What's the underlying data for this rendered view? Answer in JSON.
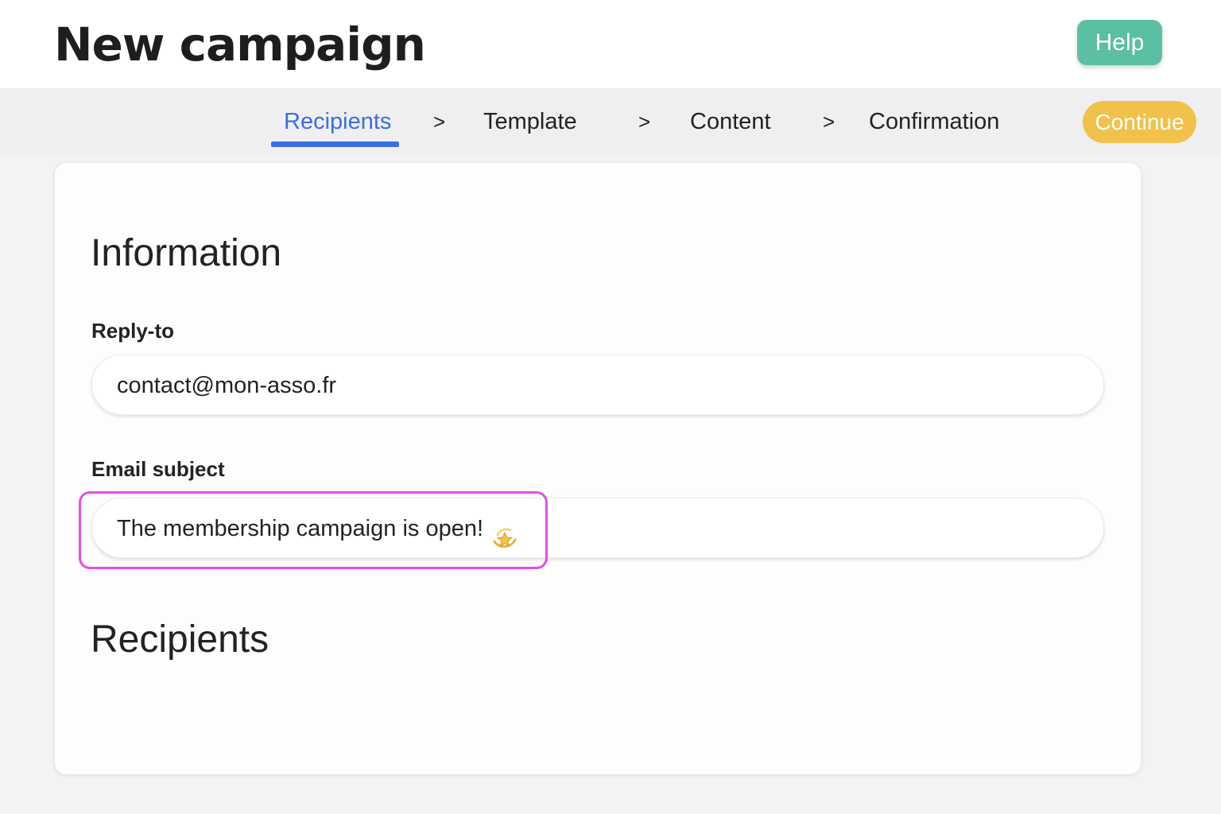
{
  "header": {
    "title": "New campaign",
    "help_label": "Help"
  },
  "stepper": {
    "steps": [
      {
        "label": "Recipients",
        "active": true
      },
      {
        "label": "Template",
        "active": false
      },
      {
        "label": "Content",
        "active": false
      },
      {
        "label": "Confirmation",
        "active": false
      }
    ],
    "separator": ">",
    "continue_label": "Continue"
  },
  "form": {
    "information_title": "Information",
    "reply_to": {
      "label": "Reply-to",
      "value": "contact@mon-asso.fr"
    },
    "email_subject": {
      "label": "Email subject",
      "value": "The membership campaign is open!",
      "emoji_icon": "dizzy-star-icon"
    },
    "recipients_title": "Recipients"
  },
  "colors": {
    "accent_blue": "#3a6fe0",
    "help_green": "#5bbfa4",
    "continue_yellow": "#f1c24b",
    "highlight_magenta": "#e84de8"
  }
}
